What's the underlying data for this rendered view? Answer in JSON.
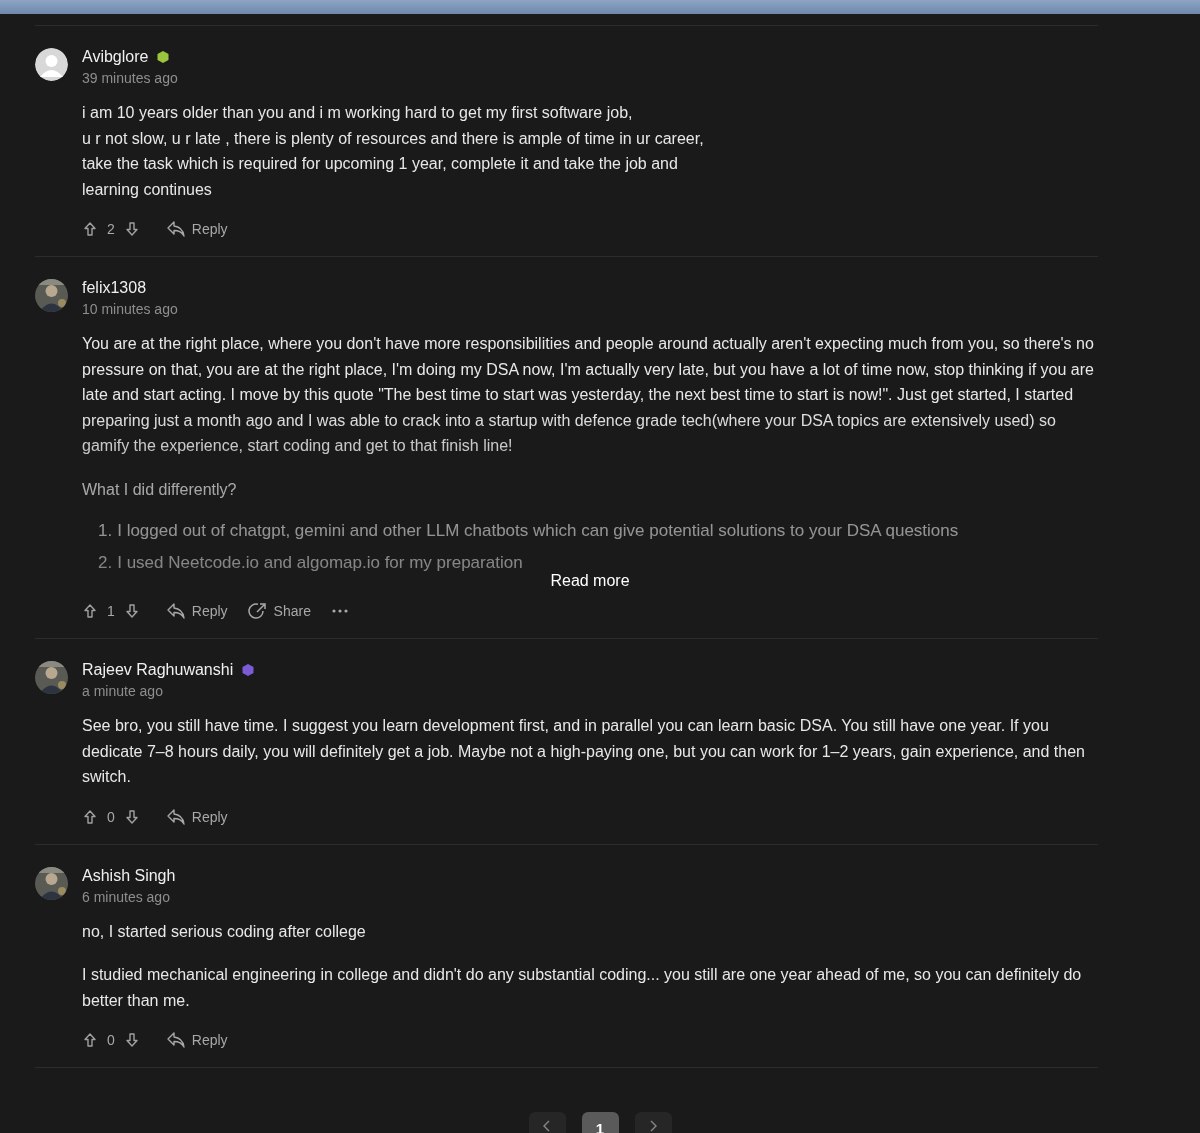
{
  "comments": [
    {
      "author": "Avibglore",
      "avatar": {
        "kind": "default"
      },
      "badge": {
        "color": "#9bc53d"
      },
      "time": "39 minutes ago",
      "truncated": false,
      "body": [
        {
          "kind": "paragraph",
          "lines": [
            "i am 10 years older than you and i m working hard to get my first software job,",
            "u r not slow, u r late , there is plenty of resources and there is ample of time in ur career,",
            "take the task which is required for upcoming 1 year, complete it and take the job and",
            "learning continues"
          ]
        }
      ],
      "votes": "2",
      "actions": [
        {
          "kind": "reply",
          "label": "Reply"
        }
      ]
    },
    {
      "author": "felix1308",
      "avatar": {
        "kind": "picture"
      },
      "time": "10 minutes ago",
      "truncated": true,
      "read_more": "Read more",
      "body": [
        {
          "kind": "paragraph",
          "text": "You are at the right place, where you don't have more responsibilities and people around actually aren't expecting much from you, so there's no pressure on that, you are at the right place, I'm doing my DSA now, I'm actually very late, but you have a lot of time now, stop thinking if you are late and start acting. I move by this quote \"The best time to start was yesterday, the next best time to start is now!\". Just get started, I started preparing just a month ago and I was able to crack into a startup with defence grade tech(where your DSA topics are extensively used) so gamify the experience, start coding and get to that finish line!"
        },
        {
          "kind": "paragraph",
          "text": "What I did differently?"
        },
        {
          "kind": "list",
          "items": [
            {
              "marker": "1.",
              "text": "I logged out of chatgpt, gemini and other LLM chatbots which can give potential solutions to your DSA questions"
            },
            {
              "marker": "2.",
              "text": "I used Neetcode.io and algomap.io for my preparation"
            }
          ]
        }
      ],
      "votes": "1",
      "actions": [
        {
          "kind": "reply",
          "label": "Reply"
        },
        {
          "kind": "share",
          "label": "Share"
        },
        {
          "kind": "more"
        }
      ]
    },
    {
      "author": "Rajeev Raghuwanshi",
      "avatar": {
        "kind": "picture"
      },
      "badge": {
        "color": "#7b5cd6"
      },
      "time": "a minute ago",
      "truncated": false,
      "body": [
        {
          "kind": "paragraph",
          "text": "See bro, you still have time. I suggest you learn development first, and in parallel you can learn basic DSA. You still have one year. If you dedicate 7–8 hours daily, you will definitely get a job. Maybe not a high-paying one, but you can work for 1–2 years, gain experience, and then switch."
        }
      ],
      "votes": "0",
      "actions": [
        {
          "kind": "reply",
          "label": "Reply"
        }
      ]
    },
    {
      "author": "Ashish Singh",
      "avatar": {
        "kind": "picture"
      },
      "time": "6 minutes ago",
      "truncated": false,
      "body": [
        {
          "kind": "paragraph",
          "text": "no, I started serious coding after college"
        },
        {
          "kind": "paragraph",
          "text": "I studied mechanical engineering in college and didn't do any substantial coding... you still are one year ahead of me, so you can definitely do better than me."
        }
      ],
      "votes": "0",
      "actions": [
        {
          "kind": "reply",
          "label": "Reply"
        }
      ]
    }
  ],
  "pagination": {
    "pages": [
      {
        "label": "1",
        "selected": true
      }
    ]
  }
}
